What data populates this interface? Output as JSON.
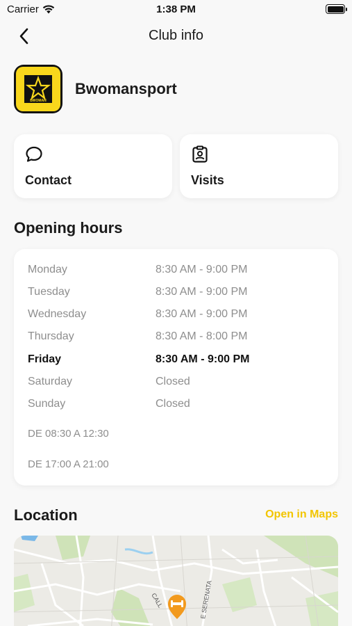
{
  "status_bar": {
    "carrier": "Carrier",
    "time": "1:38 PM"
  },
  "nav": {
    "title": "Club info"
  },
  "club": {
    "name": "Bwomansport",
    "logo_text": "BWOMAN"
  },
  "actions": {
    "contact": "Contact",
    "visits": "Visits"
  },
  "opening_hours": {
    "title": "Opening hours",
    "days": [
      {
        "day": "Monday",
        "hours": "8:30 AM - 9:00 PM",
        "today": false
      },
      {
        "day": "Tuesday",
        "hours": "8:30 AM - 9:00 PM",
        "today": false
      },
      {
        "day": "Wednesday",
        "hours": "8:30 AM - 9:00 PM",
        "today": false
      },
      {
        "day": "Thursday",
        "hours": "8:30 AM - 8:00 PM",
        "today": false
      },
      {
        "day": "Friday",
        "hours": "8:30 AM - 9:00 PM",
        "today": true
      },
      {
        "day": "Saturday",
        "hours": "Closed",
        "today": false
      },
      {
        "day": "Sunday",
        "hours": "Closed",
        "today": false
      }
    ],
    "notes": [
      "DE 08:30 A 12:30",
      "DE 17:00 A 21:00"
    ]
  },
  "location": {
    "title": "Location",
    "open_in_maps": "Open in Maps",
    "map_labels": [
      "CALL",
      "E SERENATA"
    ]
  },
  "colors": {
    "accent": "#f2c500",
    "pin": "#f29a1e"
  }
}
